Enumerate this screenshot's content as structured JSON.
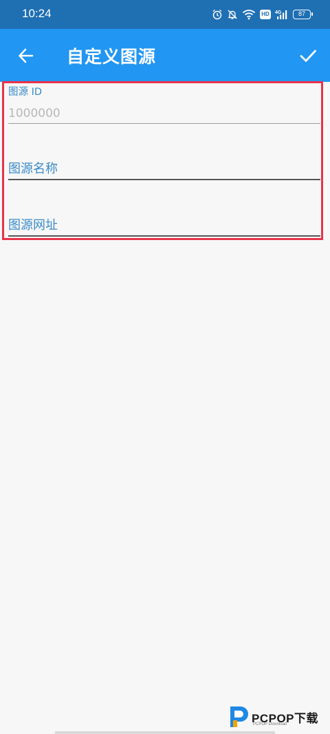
{
  "status_bar": {
    "time": "10:24",
    "icons": [
      "alarm-icon",
      "mute-icon",
      "wifi-icon",
      "hd-icon",
      "4g-signal-icon",
      "battery-icon"
    ],
    "hd_label": "HD",
    "network_label": "4G",
    "battery": "87"
  },
  "app_bar": {
    "title": "自定义图源",
    "back_icon": "arrow-left-icon",
    "confirm_icon": "check-icon",
    "background": "#2196f3"
  },
  "form": {
    "highlight_color": "#e8334a",
    "fields": [
      {
        "label": "图源 ID",
        "value": "",
        "placeholder": "1000000"
      },
      {
        "label": "图源名称",
        "value": "",
        "placeholder": ""
      },
      {
        "label": "图源网址",
        "value": "",
        "placeholder": ""
      }
    ]
  },
  "watermark": {
    "brand": "PCPOP下载",
    "sub": "PCPOP Download"
  }
}
